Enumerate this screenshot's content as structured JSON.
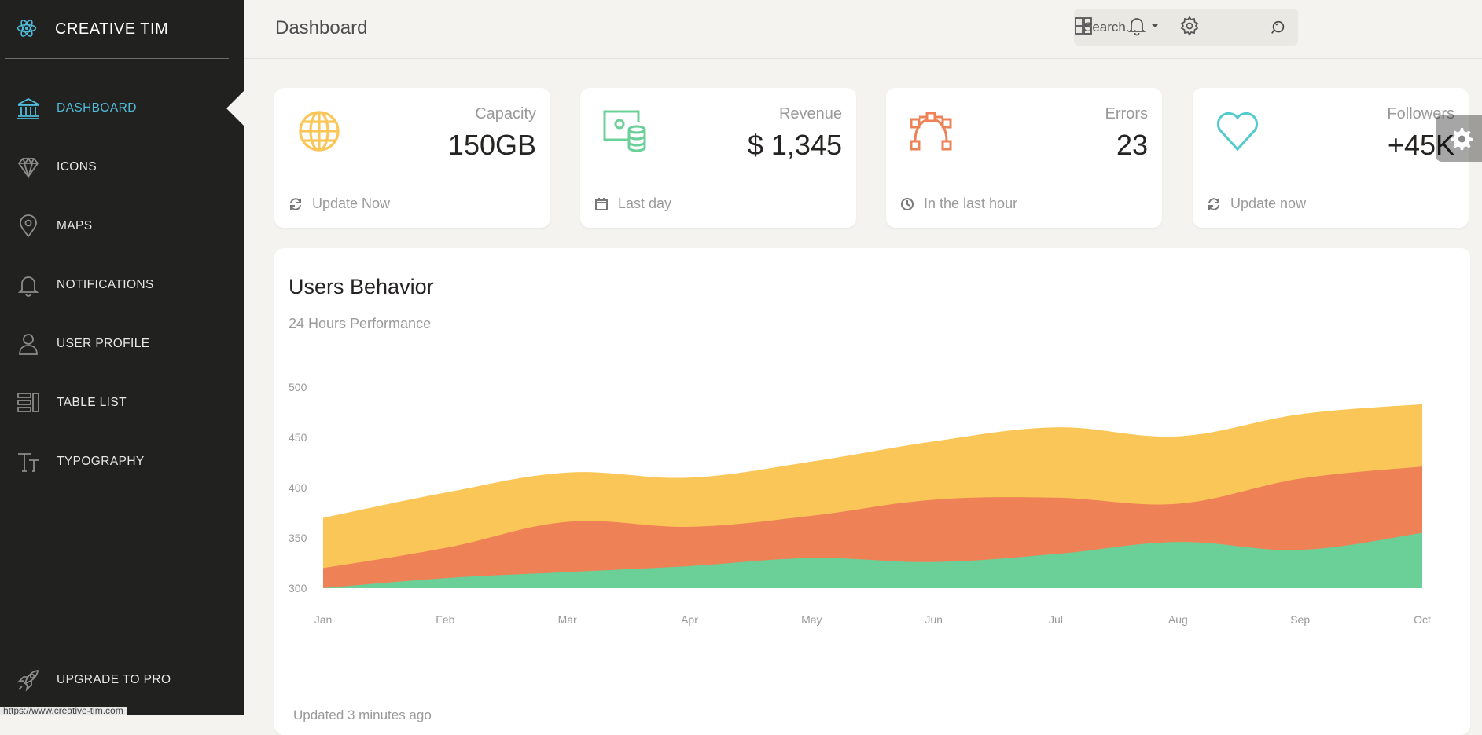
{
  "brand": {
    "name": "CREATIVE TIM"
  },
  "sidebar": {
    "items": [
      {
        "label": "DASHBOARD",
        "icon": "bank-icon",
        "active": true
      },
      {
        "label": "ICONS",
        "icon": "diamond-icon",
        "active": false
      },
      {
        "label": "MAPS",
        "icon": "map-pin-icon",
        "active": false
      },
      {
        "label": "NOTIFICATIONS",
        "icon": "bell-icon",
        "active": false
      },
      {
        "label": "USER PROFILE",
        "icon": "user-icon",
        "active": false
      },
      {
        "label": "TABLE LIST",
        "icon": "table-list-icon",
        "active": false
      },
      {
        "label": "TYPOGRAPHY",
        "icon": "typography-icon",
        "active": false
      }
    ],
    "upgrade_label": "UPGRADE TO PRO",
    "status_url": "https://www.creative-tim.com"
  },
  "header": {
    "title": "Dashboard",
    "search_placeholder": "Search..."
  },
  "stats": [
    {
      "category": "Capacity",
      "value": "150GB",
      "footer": "Update Now",
      "icon": "globe-icon",
      "footer_icon": "refresh-icon",
      "color": "#fbc658"
    },
    {
      "category": "Revenue",
      "value": "$ 1,345",
      "footer": "Last day",
      "icon": "money-coins-icon",
      "footer_icon": "calendar-icon",
      "color": "#6bd098"
    },
    {
      "category": "Errors",
      "value": "23",
      "footer": "In the last hour",
      "icon": "vector-icon",
      "footer_icon": "clock-icon",
      "color": "#ef8157"
    },
    {
      "category": "Followers",
      "value": "+45K",
      "footer": "Update now",
      "icon": "heart-icon",
      "footer_icon": "refresh-icon",
      "color": "#51cbce"
    }
  ],
  "chart": {
    "title": "Users Behavior",
    "subtitle": "24 Hours Performance",
    "footer": "Updated 3 minutes ago"
  },
  "chart_data": {
    "type": "area",
    "categories": [
      "Jan",
      "Feb",
      "Mar",
      "Apr",
      "May",
      "Jun",
      "Jul",
      "Aug",
      "Sep",
      "Oct"
    ],
    "yticks": [
      300,
      350,
      400,
      450,
      500
    ],
    "ylim": [
      300,
      500
    ],
    "series": [
      {
        "color": "#6bd098",
        "values": [
          300,
          310,
          316,
          322,
          330,
          326,
          334,
          346,
          338,
          355
        ]
      },
      {
        "color": "#ef8157",
        "values": [
          320,
          340,
          366,
          361,
          372,
          388,
          390,
          384,
          409,
          421
        ]
      },
      {
        "color": "#fbc658",
        "values": [
          370,
          395,
          415,
          410,
          426,
          446,
          460,
          451,
          473,
          483
        ]
      }
    ]
  },
  "colors": {
    "accent": "#51bcda",
    "sidebar_bg": "#212120",
    "page_bg": "#f4f3ef"
  }
}
